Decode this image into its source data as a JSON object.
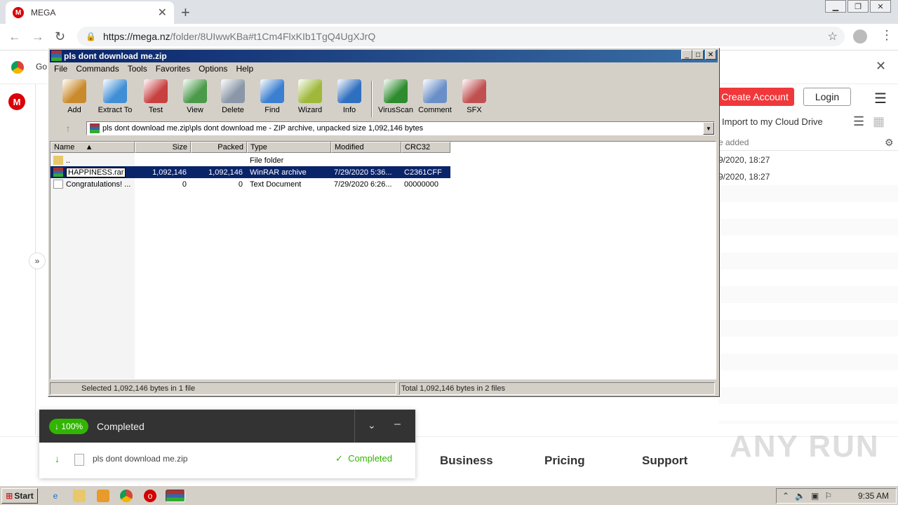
{
  "browser": {
    "tab_title": "MEGA",
    "tab_favicon": "M",
    "url_host": "https://mega.nz",
    "url_path": "/folder/8UIwwKBa#t1Cm4FlxKIb1TgQ4UgXJrQ",
    "infobar_text": "Go"
  },
  "mega": {
    "logo": "M",
    "create_account": "Create Account",
    "login": "Login",
    "import_label": "Import to my Cloud Drive",
    "col_added": "e added",
    "rows": [
      "9/2020, 18:27",
      "9/2020, 18:27"
    ],
    "footer": {
      "business": "Business",
      "pricing": "Pricing",
      "support": "Support"
    },
    "watermark": "ANY RUN"
  },
  "download": {
    "percent": "100%",
    "status": "Completed",
    "file": "pls dont download me.zip",
    "file_status": "Completed",
    "accent": "#31b500"
  },
  "winrar": {
    "title": "pls dont download me.zip",
    "menu": [
      "File",
      "Commands",
      "Tools",
      "Favorites",
      "Options",
      "Help"
    ],
    "tools": [
      {
        "label": "Add",
        "icon": "add-icon",
        "color": "#c98a2b"
      },
      {
        "label": "Extract To",
        "icon": "extract-folder-icon",
        "color": "#3f8fd6"
      },
      {
        "label": "Test",
        "icon": "test-clipboard-icon",
        "color": "#c84040"
      },
      {
        "label": "View",
        "icon": "view-book-icon",
        "color": "#4a9a4a"
      },
      {
        "label": "Delete",
        "icon": "trash-icon",
        "color": "#8a97a8"
      },
      {
        "label": "Find",
        "icon": "magnifier-icon",
        "color": "#3a7fd0"
      },
      {
        "label": "Wizard",
        "icon": "wand-icon",
        "color": "#9fb83a"
      },
      {
        "label": "Info",
        "icon": "info-icon",
        "color": "#2f6fc0"
      },
      {
        "label": "VirusScan",
        "icon": "bug-icon",
        "color": "#2e8b2e"
      },
      {
        "label": "Comment",
        "icon": "comment-icon",
        "color": "#6a8fc8"
      },
      {
        "label": "SFX",
        "icon": "sfx-books-icon",
        "color": "#c05050"
      }
    ],
    "path": "pls dont download me.zip\\pls dont download me - ZIP archive, unpacked size 1,092,146 bytes",
    "columns": [
      "Name",
      "Size",
      "Packed",
      "Type",
      "Modified",
      "CRC32"
    ],
    "files": [
      {
        "name": "..",
        "size": "",
        "packed": "",
        "type": "File folder",
        "modified": "",
        "crc": ""
      },
      {
        "name": "HAPPINESS.rar",
        "size": "1,092,146",
        "packed": "1,092,146",
        "type": "WinRAR archive",
        "modified": "7/29/2020 5:36...",
        "crc": "C2361CFF"
      },
      {
        "name": "Congratulations! ...",
        "size": "0",
        "packed": "0",
        "type": "Text Document",
        "modified": "7/29/2020 6:26...",
        "crc": "00000000"
      }
    ],
    "status_left": "Selected 1,092,146 bytes in 1 file",
    "status_right": "Total 1,092,146 bytes in 2 files"
  },
  "taskbar": {
    "start": "Start",
    "clock": "9:35 AM"
  }
}
